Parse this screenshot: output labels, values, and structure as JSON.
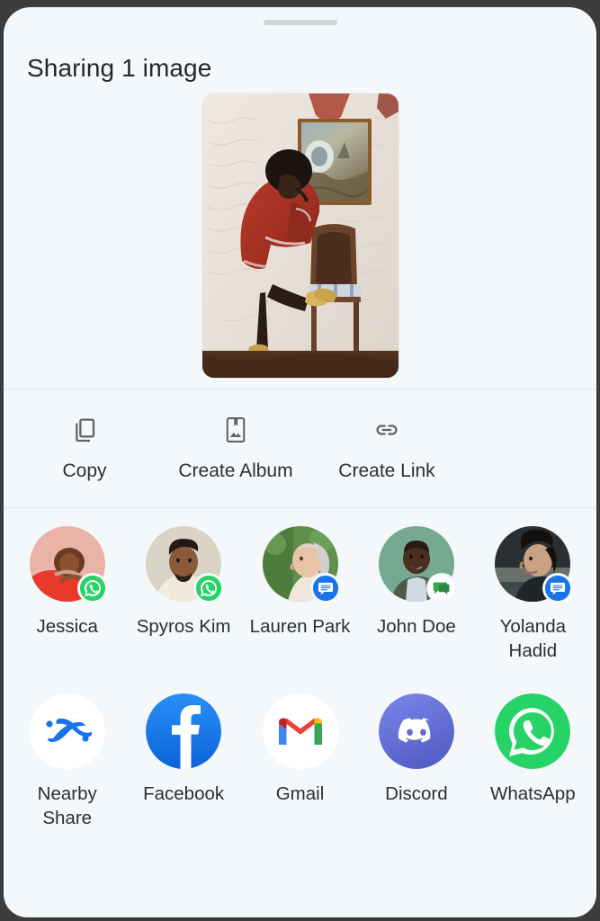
{
  "sheet": {
    "drag_handle": "drag-handle",
    "title": "Sharing 1 image",
    "preview": {
      "name": "shared-image-thumbnail",
      "description": "Photo of a woman in a red coat bending toward a wooden chair beside a framed painting on a textured white wall"
    }
  },
  "actions": [
    {
      "id": "copy",
      "label": "Copy",
      "icon": "copy-icon"
    },
    {
      "id": "create-album",
      "label": "Create Album",
      "icon": "album-icon"
    },
    {
      "id": "create-link",
      "label": "Create Link",
      "icon": "link-icon"
    }
  ],
  "contacts": [
    {
      "name": "Jessica",
      "badge": "whatsapp-badge-icon",
      "badge_color": "#25D366"
    },
    {
      "name": "Spyros Kim",
      "badge": "whatsapp-badge-icon",
      "badge_color": "#25D366"
    },
    {
      "name": "Lauren Park",
      "badge": "messages-badge-icon",
      "badge_color": "#1a73e8"
    },
    {
      "name": "John Doe",
      "badge": "messages-green-badge-icon",
      "badge_color": "#34A853"
    },
    {
      "name": "Yolanda Hadid",
      "badge": "messages-badge-icon",
      "badge_color": "#1a73e8"
    }
  ],
  "apps": [
    {
      "name": "Nearby Share",
      "icon": "nearby-share-icon",
      "color": "#1a73e8"
    },
    {
      "name": "Facebook",
      "icon": "facebook-icon",
      "color": "#1877F2"
    },
    {
      "name": "Gmail",
      "icon": "gmail-icon",
      "color": "#EA4335"
    },
    {
      "name": "Discord",
      "icon": "discord-icon",
      "color": "#5865F2"
    },
    {
      "name": "WhatsApp",
      "icon": "whatsapp-icon",
      "color": "#25D366"
    }
  ],
  "colors": {
    "sheet_background": "#f5f8fa",
    "screen_background": "#3c3c3c",
    "text_primary": "#2b2f33",
    "divider": "#e2e6e9",
    "handle": "#d2d5d7"
  }
}
